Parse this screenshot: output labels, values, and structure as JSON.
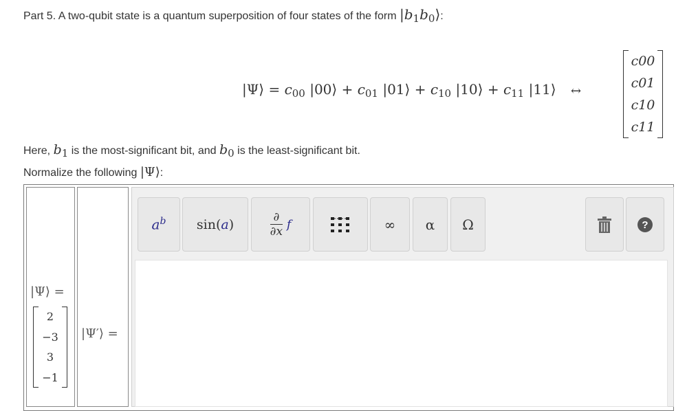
{
  "prompt": {
    "intro": "Part 5. A two-qubit state is a quantum superposition of four states of the form",
    "here_prefix": "Here,",
    "here_mid": "is the most-significant bit, and",
    "here_suffix": "is the least-significant bit.",
    "normalize_prefix": "Normalize the following",
    "colon": ":"
  },
  "coefficients": [
    "c00",
    "c01",
    "c10",
    "c11"
  ],
  "psi_vector": [
    "2",
    "−3",
    "3",
    "−1"
  ],
  "toolbar": {
    "superscript": "a^b",
    "function": "sin(a)",
    "calculus": "∂/∂x f",
    "matrix": "matrix",
    "infinity": "∞",
    "greek": "α",
    "omega": "Ω"
  },
  "colors": {
    "accent": "#4a4a4a",
    "help": "#555555",
    "toolbar_bg": "#e8e8e8",
    "editor_bg": "#f0f0f0"
  },
  "icons": [
    "trash-icon",
    "help-icon",
    "matrix-icon"
  ]
}
